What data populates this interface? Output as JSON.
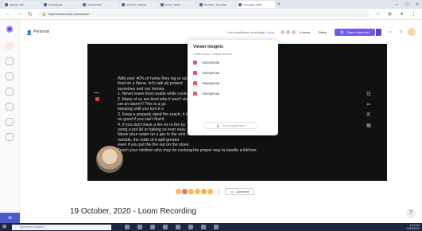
{
  "browser": {
    "tabs": [
      {
        "label": "Settings • IRL",
        "active": false
      },
      {
        "label": "(1) Facebook",
        "active": false
      },
      {
        "label": "(1) Facebook",
        "active": false
      },
      {
        "label": "(2) Inbox • Outlook",
        "active": false
      },
      {
        "label": "Home / Twitter",
        "active": false
      },
      {
        "label": "My Video - Recorded",
        "active": false
      },
      {
        "label": "19 October, 2020",
        "active": true
      }
    ],
    "new_tab": "+",
    "url": "https://www.loom.com/share/...",
    "window_controls": [
      "–",
      "□",
      "×"
    ]
  },
  "appbar": {
    "workspace": "Personal",
    "unsubscribed_text": "You unfollowed recordings.",
    "unsubscribed_link": "Undo",
    "views_label": "4 views",
    "share_label": "Share",
    "library_label": "Share video link"
  },
  "popup": {
    "title": "Viewer Insights",
    "subtitle": "4 total views, 4 unique viewers",
    "viewers": [
      "Anonymous",
      "Anonymous",
      "Anonymous",
      "Anonymous"
    ],
    "button_label": "See Engagement"
  },
  "video": {
    "lines": [
      "With over 40% of home fires                                               ing or spilling",
      "food on a flame, let's talk ab                                              protect",
      "ourselves and our homes.",
      "1.  Never leave food unatte                                                while cooking,",
      "2.  Many of us are tired whe                                               it won't stop",
      "     set an alarm!!! This is a go",
      "     beeping until you turn it o",
      "3.  Keep a properly rated fire                                               reach, it does",
      "     no good if you can't find it",
      "4.  If you don't have a fire ex                                              re fire by",
      "     using a pot lid or baking so                                              ever easy.",
      "     Never pour water on a gre                                               to the sink or",
      "     outside, the odds of it spill                                              greater",
      "     even if you put the fire out on the stove.",
      "     Teach your children who may be cooking the proper way to handle a kitchen"
    ]
  },
  "reactions": {
    "comment_label": "Comment"
  },
  "title": "19 October, 2020 - Loom Recording",
  "help_label": "?",
  "taskbar": {
    "search_placeholder": "Type here to search",
    "time": "8:11 AM",
    "date": "10/19/2020"
  },
  "colors": {
    "accent": "#6b5cf0",
    "sidebar_bottom": "#4a5ac8",
    "taskbar": "#1d2740",
    "video_bg": "#111111"
  }
}
